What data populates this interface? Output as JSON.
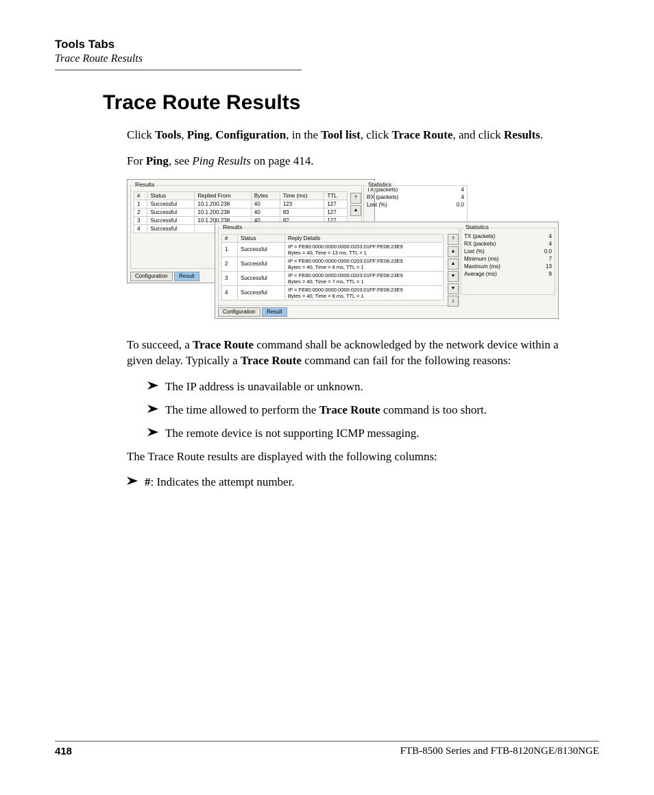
{
  "header": {
    "title": "Tools Tabs",
    "subtitle": "Trace Route Results"
  },
  "section_title": "Trace Route Results",
  "intro": {
    "click": "Click ",
    "tools": "Tools",
    "sep1": ", ",
    "ping": "Ping",
    "sep2": ", ",
    "config": "Configuration",
    "sep3": ", in the ",
    "toollist": "Tool list",
    "sep4": ", click ",
    "traceroute": "Trace Route",
    "sep5": ", and click ",
    "results": "Results",
    "end": "."
  },
  "forping": {
    "a": "For ",
    "b": "Ping",
    "c": ", see ",
    "d": "Ping Results",
    "e": " on page 414."
  },
  "panel_a": {
    "group_title": "Results",
    "headers": [
      "#",
      "Status",
      "Replied From",
      "Bytes",
      "Time (ms)",
      "TTL"
    ],
    "rows": [
      [
        "1",
        "Successful",
        "10.1.200.238",
        "40",
        "123",
        "127"
      ],
      [
        "2",
        "Successful",
        "10.1.200.238",
        "40",
        "83",
        "127"
      ],
      [
        "3",
        "Successful",
        "10.1.200.238",
        "40",
        "82",
        "127"
      ],
      [
        "4",
        "Successful",
        "",
        "",
        "",
        ""
      ]
    ],
    "stats_title": "Statistics",
    "stats": [
      [
        "TX (packets)",
        "4"
      ],
      [
        "RX (packets)",
        "4"
      ],
      [
        "Lost (%)",
        "0.0"
      ]
    ],
    "tab_config": "Configuration",
    "tab_result": "Result"
  },
  "panel_b": {
    "group_title": "Results",
    "headers": [
      "#",
      "Status",
      "Reply Details"
    ],
    "rows": [
      [
        "1",
        "Successful",
        "IP = FE80:0000:0000:0000:0203:01FF:FE08:23E9\nBytes = 40, Time = 13 ms, TTL = 1"
      ],
      [
        "2",
        "Successful",
        "IP = FE80:0000:0000:0000:0203:01FF:FE08:23E9\nBytes = 40, Time = 8 ms, TTL = 1"
      ],
      [
        "3",
        "Successful",
        "IP = FE80:0000:0000:0000:0203:01FF:FE08:23E9\nBytes = 40, Time = 7 ms, TTL = 1"
      ],
      [
        "4",
        "Successful",
        "IP = FE80:0000:0000:0000:0203:01FF:FE08:23E9\nBytes = 40, Time = 8 ms, TTL = 1"
      ]
    ],
    "stats_title": "Statistics",
    "stats": [
      [
        "TX (packets)",
        "4"
      ],
      [
        "RX (packets)",
        "4"
      ],
      [
        "Lost (%)",
        "0.0"
      ],
      [
        "Minimum (ms)",
        "7"
      ],
      [
        "Maximum (ms)",
        "13"
      ],
      [
        "Average (ms)",
        "9"
      ]
    ],
    "tab_config": "Configuration",
    "tab_result": "Result"
  },
  "para2": {
    "a": "To succeed, a ",
    "b": "Trace Route",
    "c": " command shall be acknowledged by the network device within a given delay. Typically a ",
    "d": "Trace Route",
    "e": " command can fail for the following reasons:"
  },
  "bullets1": {
    "b1": "The IP address is unavailable or unknown.",
    "b2a": "The time allowed to perform the ",
    "b2b": "Trace Route",
    "b2c": " command is too short.",
    "b3": "The remote device is not supporting ICMP messaging."
  },
  "para3": "The Trace Route results are displayed with the following columns:",
  "bullets2": {
    "hash": "#",
    "desc": ": Indicates the attempt number."
  },
  "footer": {
    "page": "418",
    "product": "FTB-8500 Series and FTB-8120NGE/8130NGE"
  }
}
